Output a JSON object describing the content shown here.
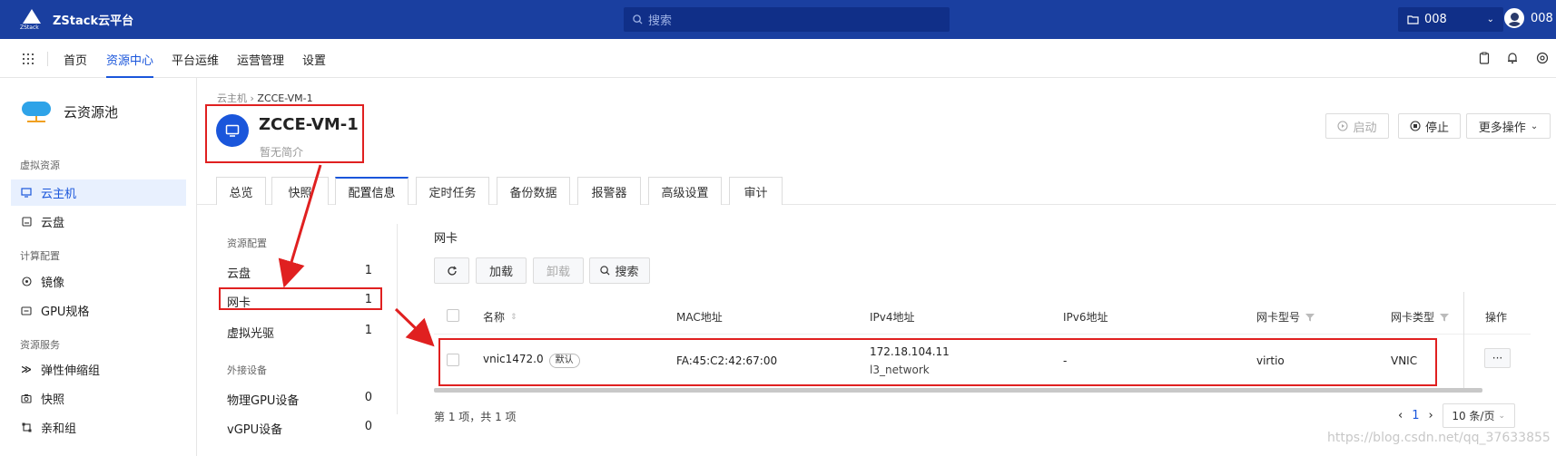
{
  "topbar": {
    "brand": "ZStack云平台",
    "brand_sub": "ZStack",
    "search_placeholder": "搜索",
    "project": "008",
    "user": "008"
  },
  "nav": {
    "items": [
      "首页",
      "资源中心",
      "平台运维",
      "运营管理",
      "设置"
    ],
    "active": "资源中心"
  },
  "sidebar": {
    "pool_title": "云资源池",
    "groups": [
      {
        "title": "虚拟资源",
        "items": [
          {
            "label": "云主机",
            "icon": "monitor-icon",
            "active": true
          },
          {
            "label": "云盘",
            "icon": "disk-icon"
          }
        ]
      },
      {
        "title": "计算配置",
        "items": [
          {
            "label": "镜像",
            "icon": "image-icon"
          },
          {
            "label": "GPU规格",
            "icon": "gpu-icon"
          }
        ]
      },
      {
        "title": "资源服务",
        "items": [
          {
            "label": "弹性伸缩组",
            "icon": "autoscale-icon"
          },
          {
            "label": "快照",
            "icon": "camera-icon"
          },
          {
            "label": "亲和组",
            "icon": "affinity-icon"
          }
        ]
      }
    ]
  },
  "header": {
    "breadcrumb_parent": "云主机",
    "breadcrumb_current": "ZCCE-VM-1",
    "vm_name": "ZCCE-VM-1",
    "vm_desc": "暂无简介",
    "start_label": "启动",
    "stop_label": "停止",
    "more_label": "更多操作"
  },
  "tabs": [
    "总览",
    "快照",
    "配置信息",
    "定时任务",
    "备份数据",
    "报警器",
    "高级设置",
    "审计"
  ],
  "active_tab": "配置信息",
  "config": {
    "group1": "资源配置",
    "items1": [
      {
        "label": "云盘",
        "count": "1"
      },
      {
        "label": "网卡",
        "count": "1"
      },
      {
        "label": "虚拟光驱",
        "count": "1"
      }
    ],
    "group2": "外接设备",
    "items2": [
      {
        "label": "物理GPU设备",
        "count": "0"
      },
      {
        "label": "vGPU设备",
        "count": "0"
      }
    ]
  },
  "nic": {
    "title": "网卡",
    "toolbar": {
      "load": "加载",
      "unload": "卸载",
      "search": "搜索"
    },
    "columns": [
      "名称",
      "MAC地址",
      "IPv4地址",
      "IPv6地址",
      "网卡型号",
      "网卡类型",
      "操作"
    ],
    "row": {
      "name": "vnic1472.0",
      "tag": "默认",
      "mac": "FA:45:C2:42:67:00",
      "ipv4": "172.18.104.11",
      "network": "l3_network",
      "ipv6": "-",
      "model": "virtio",
      "type": "VNIC",
      "action": "···"
    },
    "pager_total": "第 1 项，共 1 项",
    "page": "1",
    "page_size": "10 条/页"
  },
  "watermark": "https://blog.csdn.net/qq_37633855",
  "colors": {
    "brand": "#1a3fa0",
    "accent": "#1a56db",
    "highlight": "#e02020"
  }
}
